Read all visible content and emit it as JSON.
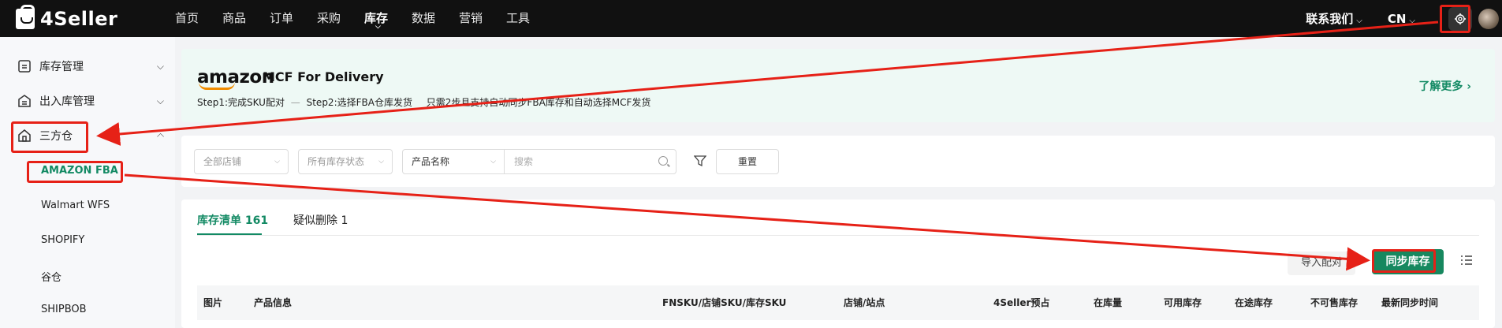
{
  "brand": {
    "name": "4Seller"
  },
  "nav": {
    "items": [
      "首页",
      "商品",
      "订单",
      "采购",
      "库存",
      "数据",
      "营销",
      "工具"
    ],
    "active_index": 4,
    "contact": "联系我们",
    "language": "CN"
  },
  "sidebar": {
    "groups": [
      {
        "label": "库存管理",
        "icon": "inventory-icon",
        "expanded": false
      },
      {
        "label": "出入库管理",
        "icon": "inout-icon",
        "expanded": false
      },
      {
        "label": "三方仓",
        "icon": "warehouse-icon",
        "expanded": true
      }
    ],
    "sub_items": [
      "AMAZON FBA",
      "Walmart WFS",
      "SHOPIFY",
      "谷仓",
      "SHIPBOB"
    ],
    "active_sub": "AMAZON FBA"
  },
  "banner": {
    "logo": "amazon",
    "title": "MCF For Delivery",
    "step1": "Step1:完成SKU配对",
    "step2": "Step2:选择FBA仓库发货",
    "note": "只需2步且支持自动同步FBA库存和自动选择MCF发货",
    "learn_more": "了解更多"
  },
  "filters": {
    "store_placeholder": "全部店铺",
    "status_placeholder": "所有库存状态",
    "field_select": "产品名称",
    "search_placeholder": "搜索",
    "reset": "重置"
  },
  "tabs": {
    "inventory": {
      "label": "库存清单",
      "count": "161"
    },
    "suspected": {
      "label": "疑似删除",
      "count": "1"
    }
  },
  "actions": {
    "import": "导入配对",
    "sync": "同步库存"
  },
  "table": {
    "columns": [
      "图片",
      "产品信息",
      "FNSKU/店铺SKU/库存SKU",
      "店铺/站点",
      "4Seller预占",
      "在库量",
      "可用库存",
      "在途库存",
      "不可售库存",
      "最新同步时间"
    ]
  },
  "colors": {
    "accent": "#138a64",
    "topbar": "#111111",
    "highlight": "#e62117",
    "banner_bg": "#eef9f5"
  }
}
